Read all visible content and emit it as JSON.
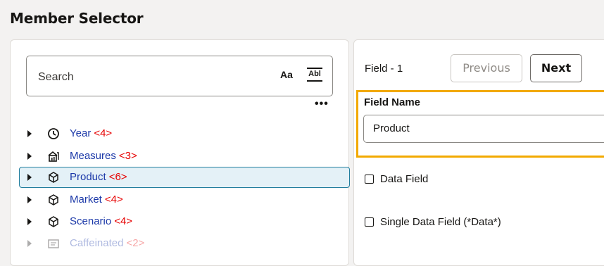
{
  "page": {
    "title": "Member Selector"
  },
  "search": {
    "placeholder": "Search",
    "match_case_label": "Aa",
    "whole_word_label": "Abl",
    "more_label": "•••"
  },
  "tree": {
    "items": [
      {
        "name": "Year",
        "count": "<4>",
        "icon": "clock-icon"
      },
      {
        "name": "Measures",
        "count": "<3>",
        "icon": "measures-icon"
      },
      {
        "name": "Product",
        "count": "<6>",
        "icon": "cube-icon",
        "selected": true
      },
      {
        "name": "Market",
        "count": "<4>",
        "icon": "cube-icon"
      },
      {
        "name": "Scenario",
        "count": "<4>",
        "icon": "cube-icon"
      },
      {
        "name": "Caffeinated",
        "count": "<2>",
        "icon": "attribute-icon"
      }
    ]
  },
  "field": {
    "number_label": "Field - 1",
    "previous_label": "Previous",
    "next_label": "Next",
    "name_label": "Field Name",
    "name_value": "Product",
    "data_field_label": "Data Field",
    "single_data_field_label": "Single Data Field (*Data*)"
  },
  "colors": {
    "member_name": "#1b38a8",
    "member_count": "#e60000",
    "selection_border": "#227e9e",
    "highlight": "#f2a900"
  }
}
